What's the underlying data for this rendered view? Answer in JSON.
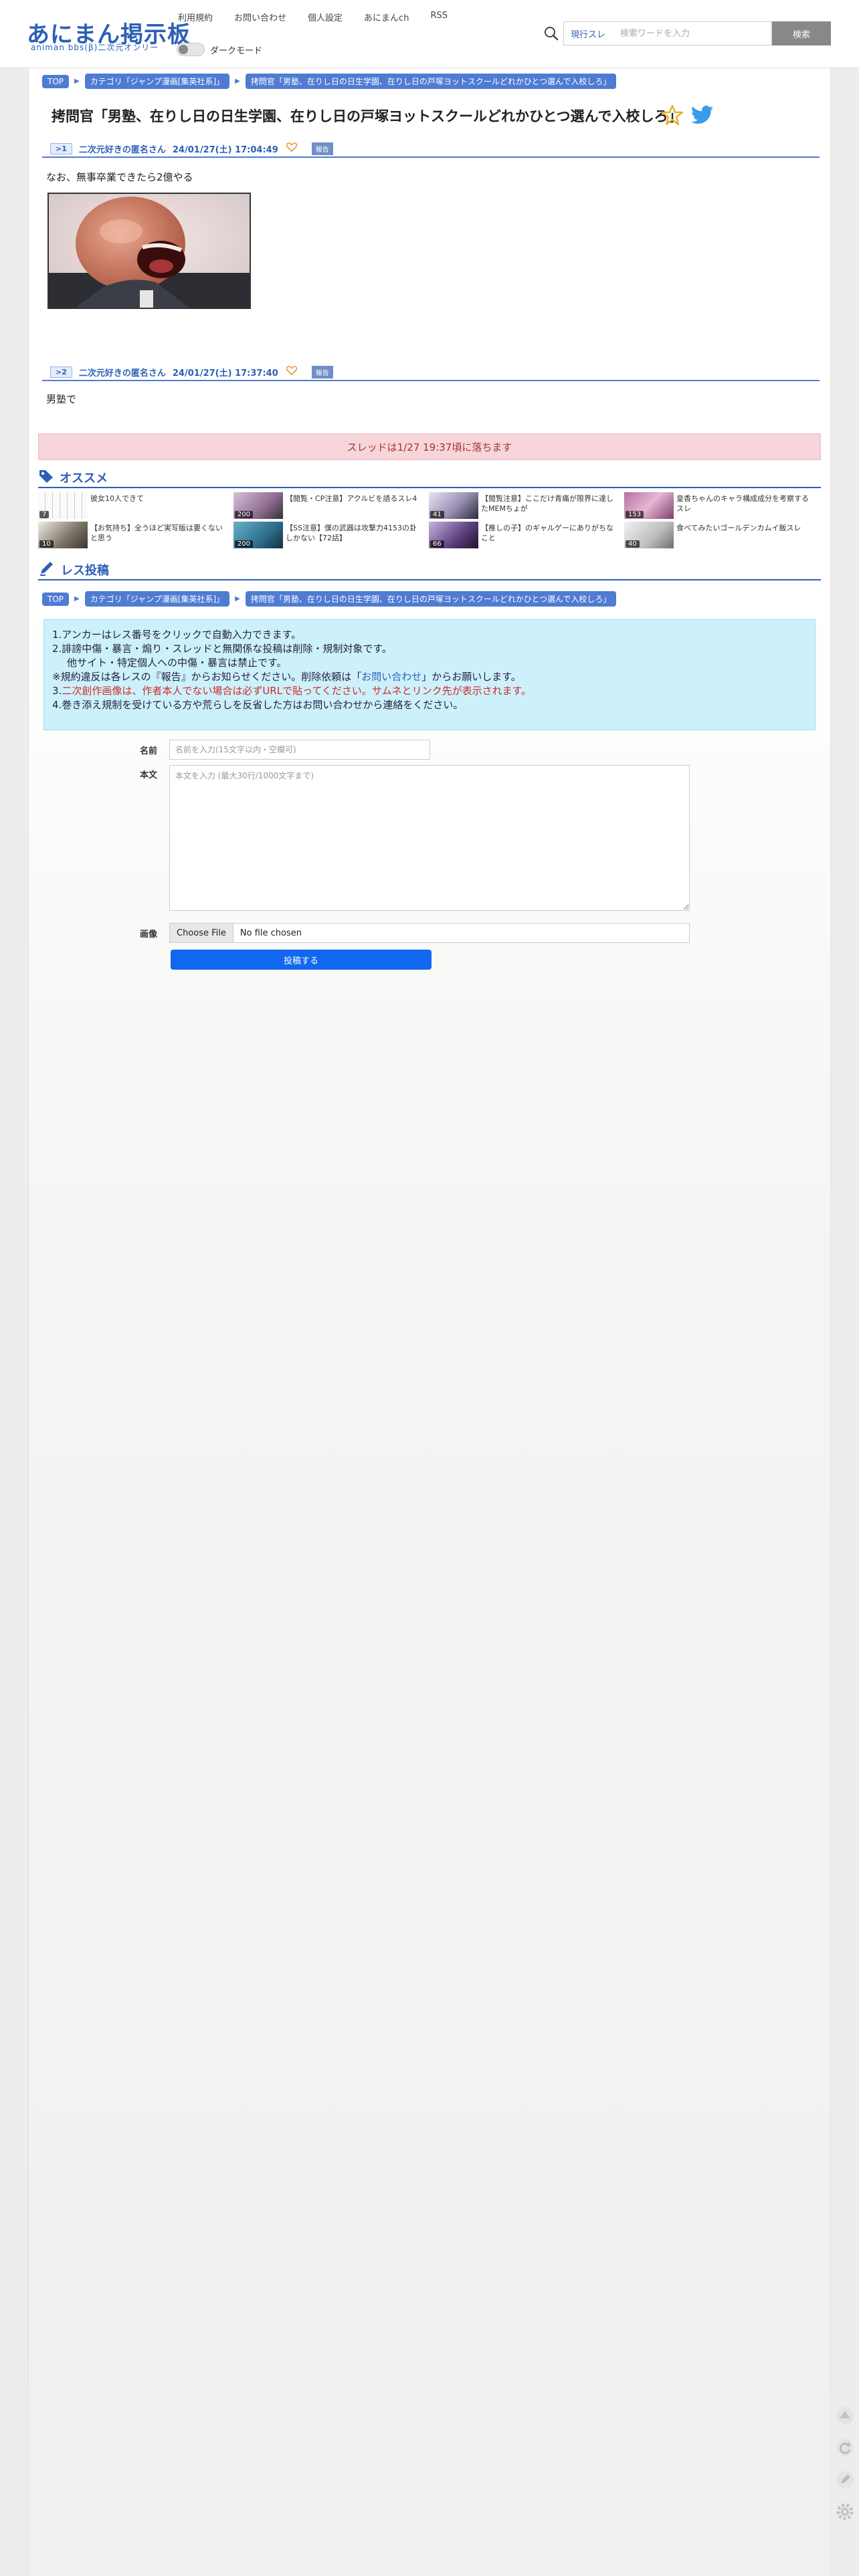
{
  "header": {
    "logo_main": "あにまん掲示板",
    "logo_sub": "animan bbs(β)二次元オンリー",
    "nav": [
      "利用規約",
      "お問い合わせ",
      "個人設定",
      "あにまんch",
      "RSS"
    ],
    "dark_mode_label": "ダークモード",
    "search": {
      "type": "現行スレ",
      "placeholder": "検索ワードを入力",
      "button": "検索"
    }
  },
  "breadcrumb": [
    "TOP",
    "カテゴリ「ジャンプ漫画[集英社系]」",
    "拷問官「男塾、在りし日の日生学園、在りし日の戸塚ヨットスクールどれかひとつ選んで入校しろ」"
  ],
  "thread": {
    "title": "拷問官「男塾、在りし日の日生学園、在りし日の戸塚ヨットスクールどれかひとつ選んで入校しろ」"
  },
  "posts": [
    {
      "num": ">1",
      "name": "二次元好きの匿名さん",
      "date": "24/01/27(土) 17:04:49",
      "report": "報告",
      "body": "なお、無事卒業できたら2億やる"
    },
    {
      "num": ">2",
      "name": "二次元好きの匿名さん",
      "date": "24/01/27(土) 17:37:40",
      "report": "報告",
      "body": "男塾で"
    }
  ],
  "fall_notice": "スレッドは1/27 19:37頃に落ちます",
  "recommend": {
    "title": "オススメ",
    "items": [
      {
        "title": "彼女10人できて",
        "count": "7"
      },
      {
        "title": "【閲覧・CP注意】アクルビを語るスレ4",
        "count": "200"
      },
      {
        "title": "【閲覧注意】ここだけ青痛が限界に達したMEMちょが",
        "count": "41"
      },
      {
        "title": "皇香ちゃんのキャラ構成成分を考察するスレ",
        "count": "153"
      },
      {
        "title": "【お気持ち】全うほど実写版は要くないと思う",
        "count": "10"
      },
      {
        "title": "【SS注意】僕の武器は攻撃力4153の卦しかない【72話】",
        "count": "200"
      },
      {
        "title": "【推しの子】のギャルゲーにありがちなこと",
        "count": "66"
      },
      {
        "title": "食べてみたいゴールデンカムイ飯スレ",
        "count": "40"
      }
    ]
  },
  "reply": {
    "title": "レス投稿",
    "rules": {
      "l1": "1.アンカーはレス番号をクリックで自動入力できます。",
      "l2": "2.誹謗中傷・暴言・煽り・スレッドと無関係な投稿は削除・規制対象です。",
      "l2b": "他サイト・特定個人への中傷・暴言は禁止です。",
      "l3a": "※規約違反は各レスの『報告』からお知らせください。削除依頼は「",
      "l3link": "お問い合わせ",
      "l3b": "」からお願いします。",
      "l4a": "3.",
      "l4red1": "二次創作画像は、",
      "l4red2": "作者本人でない場合は必ずURLで貼ってください。サムネとリンク先が表示されます。",
      "l5": "4.巻き添え規制を受けている方や荒らしを反省した方はお問い合わせから連絡をください。"
    },
    "name_label": "名前",
    "name_placeholder": "名前を入力(15文字以内・空欄可)",
    "body_label": "本文",
    "body_placeholder": "本文を入力 (最大30行/1000文字まで)",
    "image_label": "画像",
    "file_button": "Choose File",
    "file_status": "No file chosen",
    "submit": "投稿する"
  },
  "colors": {
    "accent": "#2c5fb6",
    "crumb": "#4f7bd3",
    "notice_bg": "#f6d6da",
    "rules_bg": "#cdf1fa",
    "submit": "#1168ef"
  }
}
